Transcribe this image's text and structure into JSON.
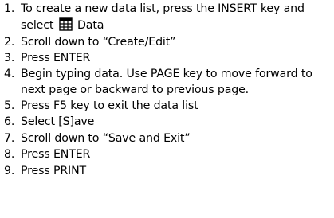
{
  "steps": [
    {
      "num": "1.",
      "text": "To create a new data list, press the INSERT key and select",
      "after_icon": "Data",
      "icon": "data-list-icon"
    },
    {
      "num": "2.",
      "text": "Scroll down to “Create/Edit”"
    },
    {
      "num": "3.",
      "text": "Press ENTER"
    },
    {
      "num": "4.",
      "text": "Begin typing data.  Use PAGE key to move forward to next page or backward to previous page."
    },
    {
      "num": "5.",
      "text": "Press F5 key to exit the data list"
    },
    {
      "num": "6.",
      "text": "Select [S]ave"
    },
    {
      "num": "7.",
      "text": "Scroll down to “Save and Exit”"
    },
    {
      "num": "8.",
      "text": "Press ENTER"
    },
    {
      "num": "9.",
      "text": "Press PRINT"
    }
  ]
}
